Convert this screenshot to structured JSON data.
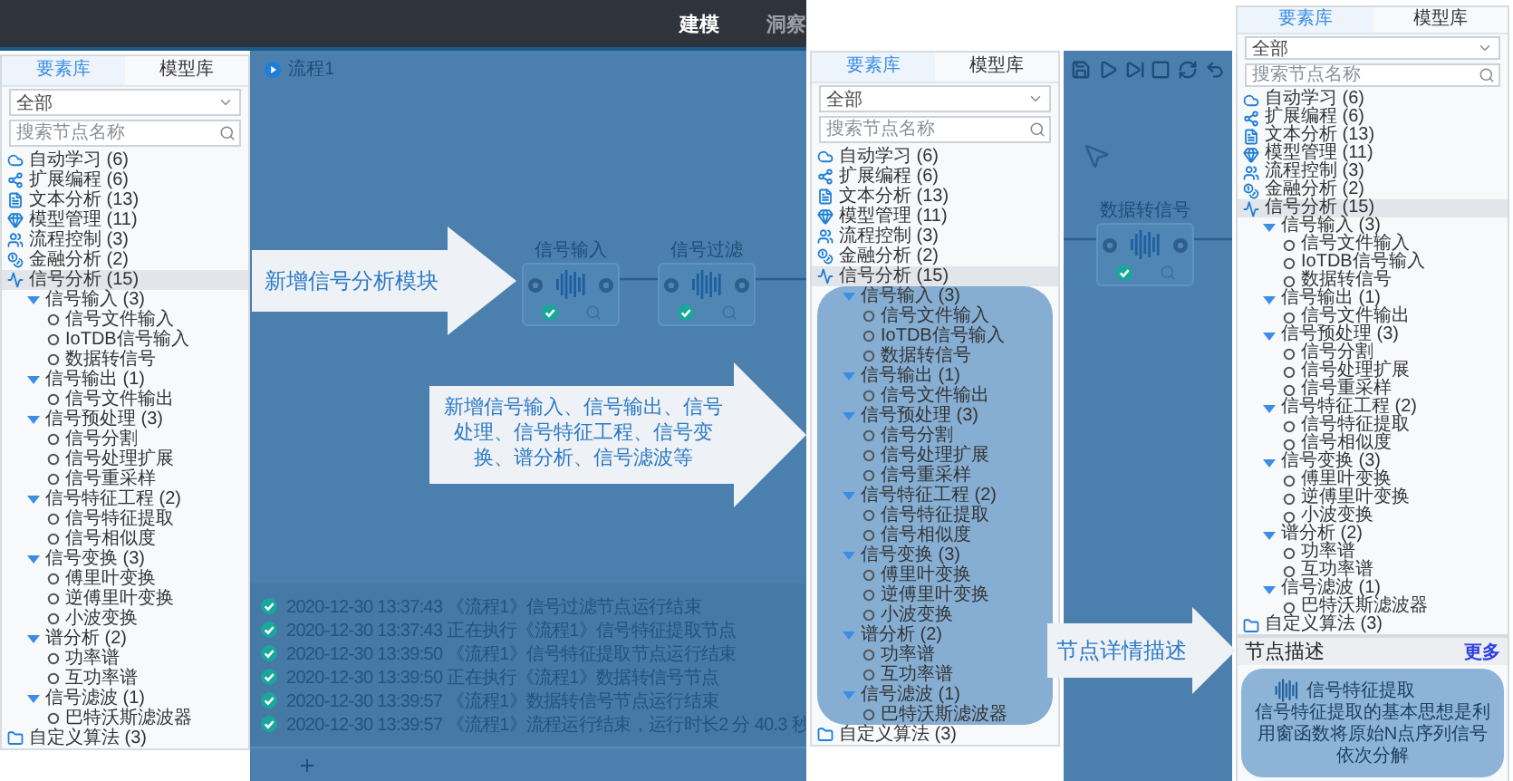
{
  "top_bar": {
    "tabs": [
      {
        "label": "建模",
        "selected": true
      },
      {
        "label": "洞察",
        "selected": false
      }
    ]
  },
  "panels": [
    {
      "tabs": [
        {
          "label": "要素库",
          "selected": true
        },
        {
          "label": "模型库",
          "selected": false
        }
      ],
      "select": "全部",
      "search": {
        "placeholder": "搜索节点名称"
      },
      "tree": [
        {
          "label": "自动学习 (6)",
          "selected": false
        },
        {
          "label": "扩展编程 (6)",
          "selected": false
        },
        {
          "label": "文本分析 (13)",
          "selected": false
        },
        {
          "label": "模型管理 (11)",
          "selected": false
        },
        {
          "label": "流程控制 (3)",
          "selected": false
        },
        {
          "label": "金融分析 (2)",
          "selected": false
        },
        {
          "label": "信号分析 (15)",
          "selected": true,
          "expanded": true,
          "highlighted": false,
          "children": [
            {
              "label": "信号输入 (3)",
              "expanded": true,
              "children": [
                {
                  "label": "信号文件输入"
                },
                {
                  "label": "IoTDB信号输入"
                },
                {
                  "label": "数据转信号"
                }
              ]
            },
            {
              "label": "信号输出 (1)",
              "expanded": true,
              "children": [
                {
                  "label": "信号文件输出"
                }
              ]
            },
            {
              "label": "信号预处理 (3)",
              "expanded": true,
              "children": [
                {
                  "label": "信号分割"
                },
                {
                  "label": "信号处理扩展"
                },
                {
                  "label": "信号重采样"
                }
              ]
            },
            {
              "label": "信号特征工程 (2)",
              "expanded": true,
              "children": [
                {
                  "label": "信号特征提取"
                },
                {
                  "label": "信号相似度"
                }
              ]
            },
            {
              "label": "信号变换 (3)",
              "expanded": true,
              "children": [
                {
                  "label": "傅里叶变换"
                },
                {
                  "label": "逆傅里叶变换"
                },
                {
                  "label": "小波变换"
                }
              ]
            },
            {
              "label": "谱分析 (2)",
              "expanded": true,
              "children": [
                {
                  "label": "功率谱"
                },
                {
                  "label": "互功率谱"
                }
              ]
            },
            {
              "label": "信号滤波 (1)",
              "expanded": true,
              "children": [
                {
                  "label": "巴特沃斯滤波器"
                }
              ]
            }
          ]
        },
        {
          "label": "自定义算法 (3)",
          "selected": false
        }
      ]
    },
    {
      "tabs": [
        {
          "label": "要素库",
          "selected": true
        },
        {
          "label": "模型库",
          "selected": false
        }
      ],
      "select": "全部",
      "search": {
        "placeholder": "搜索节点名称"
      },
      "tree": [
        {
          "label": "自动学习 (6)",
          "selected": false
        },
        {
          "label": "扩展编程 (6)",
          "selected": false
        },
        {
          "label": "文本分析 (13)",
          "selected": false
        },
        {
          "label": "模型管理 (11)",
          "selected": false
        },
        {
          "label": "流程控制 (3)",
          "selected": false
        },
        {
          "label": "金融分析 (2)",
          "selected": false
        },
        {
          "label": "信号分析 (15)",
          "selected": true,
          "expanded": true,
          "highlighted": true,
          "children": [
            {
              "label": "信号输入 (3)",
              "expanded": true,
              "children": [
                {
                  "label": "信号文件输入"
                },
                {
                  "label": "IoTDB信号输入"
                },
                {
                  "label": "数据转信号"
                }
              ]
            },
            {
              "label": "信号输出 (1)",
              "expanded": true,
              "children": [
                {
                  "label": "信号文件输出"
                }
              ]
            },
            {
              "label": "信号预处理 (3)",
              "expanded": true,
              "children": [
                {
                  "label": "信号分割"
                },
                {
                  "label": "信号处理扩展"
                },
                {
                  "label": "信号重采样"
                }
              ]
            },
            {
              "label": "信号特征工程 (2)",
              "expanded": true,
              "children": [
                {
                  "label": "信号特征提取"
                },
                {
                  "label": "信号相似度"
                }
              ]
            },
            {
              "label": "信号变换 (3)",
              "expanded": true,
              "children": [
                {
                  "label": "傅里叶变换"
                },
                {
                  "label": "逆傅里叶变换"
                },
                {
                  "label": "小波变换"
                }
              ]
            },
            {
              "label": "谱分析 (2)",
              "expanded": true,
              "children": [
                {
                  "label": "功率谱"
                },
                {
                  "label": "互功率谱"
                }
              ]
            },
            {
              "label": "信号滤波 (1)",
              "expanded": true,
              "children": [
                {
                  "label": "巴特沃斯滤波器"
                }
              ]
            }
          ]
        },
        {
          "label": "自定义算法 (3)",
          "selected": false
        }
      ]
    },
    {
      "tabs": [
        {
          "label": "要素库",
          "selected": true
        },
        {
          "label": "模型库",
          "selected": false
        }
      ],
      "select": "全部",
      "search": {
        "placeholder": "搜索节点名称"
      },
      "tree": [
        {
          "label": "自动学习 (6)",
          "selected": false
        },
        {
          "label": "扩展编程 (6)",
          "selected": false
        },
        {
          "label": "文本分析 (13)",
          "selected": false
        },
        {
          "label": "模型管理 (11)",
          "selected": false
        },
        {
          "label": "流程控制 (3)",
          "selected": false
        },
        {
          "label": "金融分析 (2)",
          "selected": false
        },
        {
          "label": "信号分析 (15)",
          "selected": true,
          "expanded": true,
          "highlighted": false,
          "children": [
            {
              "label": "信号输入 (3)",
              "expanded": true,
              "children": [
                {
                  "label": "信号文件输入"
                },
                {
                  "label": "IoTDB信号输入"
                },
                {
                  "label": "数据转信号"
                }
              ]
            },
            {
              "label": "信号输出 (1)",
              "expanded": true,
              "children": [
                {
                  "label": "信号文件输出"
                }
              ]
            },
            {
              "label": "信号预处理 (3)",
              "expanded": true,
              "children": [
                {
                  "label": "信号分割"
                },
                {
                  "label": "信号处理扩展"
                },
                {
                  "label": "信号重采样"
                }
              ]
            },
            {
              "label": "信号特征工程 (2)",
              "expanded": true,
              "children": [
                {
                  "label": "信号特征提取"
                },
                {
                  "label": "信号相似度"
                }
              ]
            },
            {
              "label": "信号变换 (3)",
              "expanded": true,
              "children": [
                {
                  "label": "傅里叶变换"
                },
                {
                  "label": "逆傅里叶变换"
                },
                {
                  "label": "小波变换"
                }
              ]
            },
            {
              "label": "谱分析 (2)",
              "expanded": true,
              "children": [
                {
                  "label": "功率谱"
                },
                {
                  "label": "互功率谱"
                }
              ]
            },
            {
              "label": "信号滤波 (1)",
              "expanded": true,
              "children": [
                {
                  "label": "巴特沃斯滤波器"
                }
              ]
            }
          ]
        },
        {
          "label": "自定义算法 (3)",
          "selected": false
        }
      ]
    }
  ],
  "canvas": {
    "title": "流程1",
    "nodes": [
      {
        "label": "信号输入"
      },
      {
        "label": "信号过滤"
      }
    ],
    "log": [
      {
        "text": "2020-12-30 13:37:43 《流程1》信号过滤节点运行结束"
      },
      {
        "text": "2020-12-30 13:37:43 正在执行《流程1》信号特征提取节点"
      },
      {
        "text": "2020-12-30 13:39:50 《流程1》信号特征提取节点运行结束"
      },
      {
        "text": "2020-12-30 13:39:50 正在执行《流程1》数据转信号节点"
      },
      {
        "text": "2020-12-30 13:39:57 《流程1》数据转信号节点运行结束"
      },
      {
        "text": "2020-12-30 13:39:57 《流程1》流程运行结束，运行时长2 分 40.3 秒"
      }
    ]
  },
  "side_node": {
    "label": "数据转信号"
  },
  "node_description": {
    "title": "节点描述",
    "more": "更多",
    "name": "信号特征提取",
    "text": "信号特征提取的基本思想是利用窗函数将原始N点序列信号依次分解"
  },
  "callouts": [
    {
      "text": "新增信号分析模块"
    },
    {
      "text": "新增信号输入、信号输出、信号处理、信号特征工程、信号变换、谱分析、信号滤波等"
    },
    {
      "text": "节点详情描述"
    }
  ]
}
